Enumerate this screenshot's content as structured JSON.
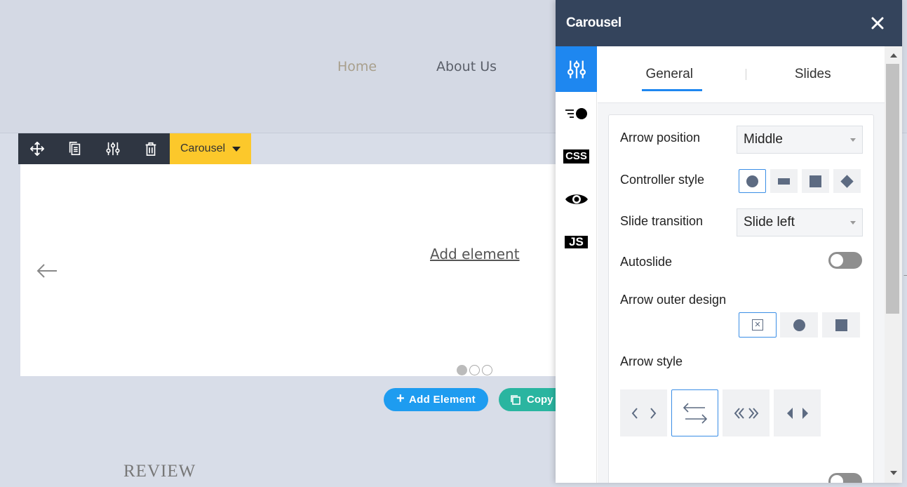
{
  "site": {
    "nav": {
      "home": "Home",
      "about": "About Us"
    },
    "carousel": {
      "add_element_link": "Add element",
      "dot_count": 3,
      "active_dot": 1
    },
    "toolbar": {
      "element_type": "Carousel"
    },
    "actions": {
      "add_element": "Add Element",
      "copy": "Copy"
    },
    "review_heading": "REVIEW"
  },
  "panel": {
    "title": "Carousel",
    "side_tabs": [
      "settings-sliders-icon",
      "animation-icon",
      "CSS",
      "visibility-eye-icon",
      "JS"
    ],
    "side_tab_labels": {
      "css": "CSS",
      "js": "JS"
    },
    "tabs": {
      "general": "General",
      "slides": "Slides"
    },
    "active_tab": "General",
    "fields": {
      "arrow_position": {
        "label": "Arrow position",
        "value": "Middle"
      },
      "controller_style": {
        "label": "Controller style",
        "options": [
          "circle",
          "bar",
          "square",
          "diamond"
        ],
        "selected": "circle"
      },
      "slide_transition": {
        "label": "Slide transition",
        "value": "Slide left"
      },
      "autoslide": {
        "label": "Autoslide",
        "enabled": false
      },
      "arrow_outer_design": {
        "label": "Arrow outer design",
        "options": [
          "none",
          "circle",
          "square"
        ],
        "selected": "none"
      },
      "arrow_style": {
        "label": "Arrow style",
        "options": [
          "chevron",
          "long-arrow",
          "double-chevron",
          "triangle"
        ],
        "selected": "long-arrow"
      }
    }
  },
  "colors": {
    "panel_header": "#34445c",
    "accent_blue": "#1e87f0",
    "toolbar_yellow": "#fcc82b",
    "add_button": "#1e9cf0",
    "copy_button": "#2ab5a0"
  }
}
